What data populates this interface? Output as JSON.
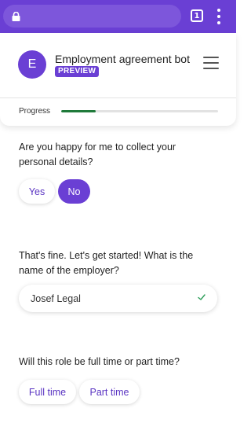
{
  "browser": {
    "tab_count": "1"
  },
  "header": {
    "avatar_letter": "E",
    "title": "Employment agreement bot",
    "badge": "PREVIEW",
    "progress_label": "Progress",
    "progress_fraction": 0.22
  },
  "conversation": {
    "q1": "Are you happy for me to collect your personal details?",
    "q1_options": [
      "Yes",
      "No"
    ],
    "q1_selected": "No",
    "q2": "That's fine. Let's get started! What is the name of the employer?",
    "q2_answer": "Josef Legal",
    "q3": "Will this role be full time or part time?",
    "q3_options": [
      "Full time",
      "Part time"
    ]
  },
  "colors": {
    "brand": "#6a3fd4",
    "progress": "#1f7a3a",
    "check": "#2e9e5b"
  }
}
